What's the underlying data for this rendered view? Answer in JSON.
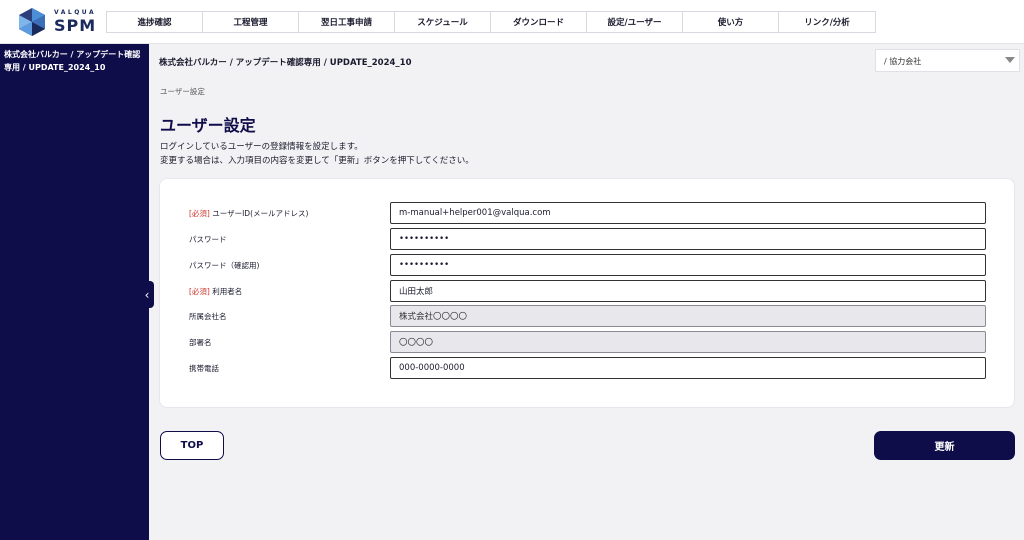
{
  "brand": {
    "small": "VALQUA",
    "big": "SPM",
    "color": "#1a2a5c"
  },
  "nav": [
    {
      "label": "進捗確認"
    },
    {
      "label": "工程管理"
    },
    {
      "label": "翌日工事申請"
    },
    {
      "label": "スケジュール"
    },
    {
      "label": "ダウンロード"
    },
    {
      "label": "設定/ユーザー"
    },
    {
      "label": "使い方"
    },
    {
      "label": "リンク/分析"
    }
  ],
  "sidebar": {
    "title": "株式会社バルカー / アップデート確認専用 / UPDATE_2024_10",
    "color": "#0f0c4a"
  },
  "header_breadcrumb": "株式会社バルカー / アップデート確認専用 / UPDATE_2024_10",
  "company_select": {
    "value": "/ 協力会社"
  },
  "crumb": "ユーザー設定",
  "page_title": "ユーザー設定",
  "description": [
    "ログインしているユーザーの登録情報を設定します。",
    "変更する場合は、入力項目の内容を変更して「更新」ボタンを押下してください。"
  ],
  "form": {
    "required_tag": "[必須]",
    "fields": [
      {
        "label": "ユーザーID(メールアドレス)",
        "value": "m-manual+helper001@valqua.com"
      },
      {
        "label": "パスワード",
        "value": "••••••••••"
      },
      {
        "label": "パスワード（確認用)",
        "value": "••••••••••"
      },
      {
        "label": "利用者名",
        "value": "山田太郎"
      },
      {
        "label": "所属会社名",
        "value": "株式会社〇〇〇〇"
      },
      {
        "label": "部署名",
        "value": "〇〇〇〇"
      },
      {
        "label": "携帯電話",
        "value": "000-0000-0000"
      }
    ]
  },
  "buttons": {
    "top": "TOP",
    "update": "更新"
  }
}
